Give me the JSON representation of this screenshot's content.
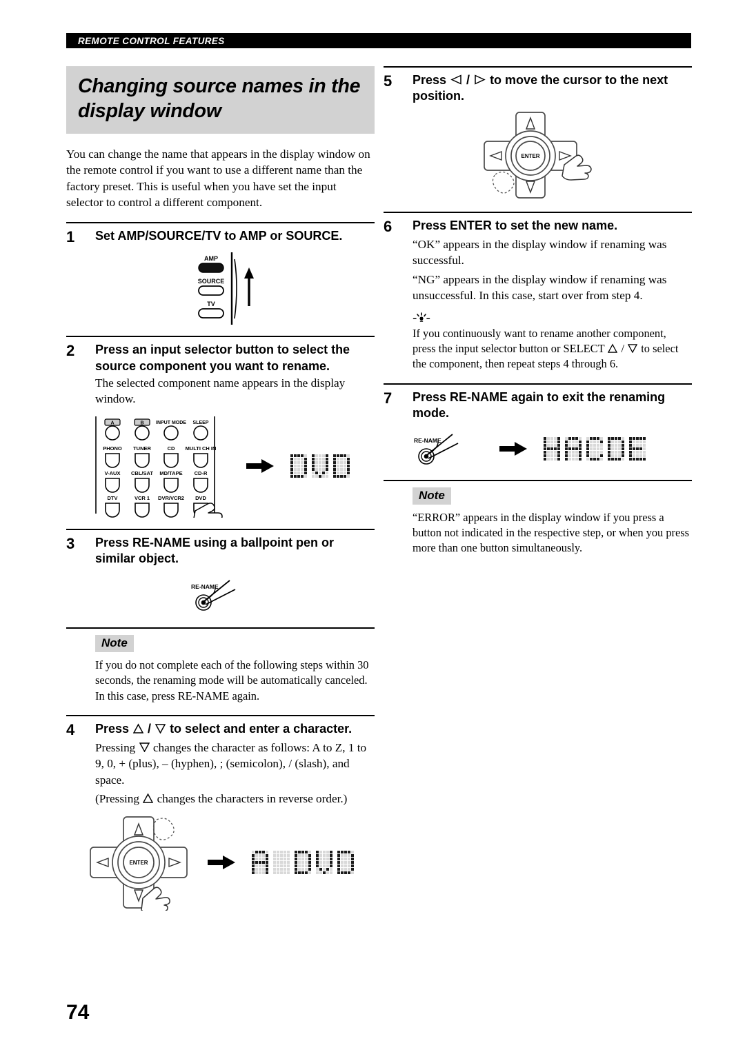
{
  "running_head": "REMOTE CONTROL FEATURES",
  "page_number": "74",
  "section": {
    "title": "Changing source names in the display window",
    "intro": "You can change the name that appears in the display window on the remote control if you want to use a different name than the factory preset. This is useful when you have set the input selector to control a different component."
  },
  "steps": [
    {
      "number": "1",
      "title": "Set AMP/SOURCE/TV to AMP or SOURCE.",
      "body": ""
    },
    {
      "number": "2",
      "title": "Press an input selector button to select the source component you want to rename.",
      "body": "The selected component name appears in the display window."
    },
    {
      "number": "3",
      "title": "Press RE-NAME using a ballpoint pen or similar object.",
      "body": ""
    },
    {
      "number": "4",
      "title_pre": "Press ",
      "title_mid": " / ",
      "title_post": " to select and enter a character.",
      "body_line1_pre": "Pressing ",
      "body_line1_post": " changes the character as follows: A to Z, 1 to 9, 0, + (plus), – (hyphen), ; (semicolon), / (slash), and space.",
      "body_line2_pre": "(Pressing ",
      "body_line2_post": " changes the characters in reverse order.)"
    },
    {
      "number": "5",
      "title_pre": "Press ",
      "title_mid": " / ",
      "title_post": " to move the cursor to the next position."
    },
    {
      "number": "6",
      "title": "Press ENTER to set the new name.",
      "body_line1": "“OK” appears in the display window if renaming was successful.",
      "body_line2": "“NG” appears in the display window if renaming was unsuccessful. In this case, start over from step 4."
    },
    {
      "number": "7",
      "title": "Press RE-NAME again to exit the renaming mode.",
      "body": ""
    }
  ],
  "notes": {
    "tag": "Note",
    "left_text": "If you do not complete each of the following steps within 30 seconds, the renaming mode will be automatically canceled. In this case, press RE-NAME again.",
    "right_text": "“ERROR” appears in the display window if you press a button not indicated in the respective step, or when you press more than one button simultaneously."
  },
  "tip": {
    "text_pre": "If you continuously want to rename another component, press the input selector button or SELECT ",
    "text_mid": " / ",
    "text_post": " to select the component, then repeat steps 4 through 6."
  },
  "figures": {
    "mode_switch": {
      "labels": [
        "AMP",
        "SOURCE",
        "TV"
      ],
      "selected": "AMP"
    },
    "input_selector_grid": {
      "rows": [
        [
          "A",
          "B",
          "INPUT MODE",
          "SLEEP"
        ],
        [
          "PHONO",
          "TUNER",
          "CD",
          "MULTI CH IN"
        ],
        [
          "V-AUX",
          "CBL/SAT",
          "MD/TAPE",
          "CD-R"
        ],
        [
          "DTV",
          "VCR 1",
          "DVR/VCR2",
          "DVD"
        ]
      ],
      "pressed": "DVD"
    },
    "rename_button_label": "RE-NAME",
    "cursor_pad": {
      "center_label": "ENTER",
      "up": "up-triangle",
      "down": "down-triangle",
      "left": "left-triangle",
      "right": "right-triangle"
    },
    "lcd_step2": "DVD",
    "lcd_step4": "A DVD",
    "lcd_step7": "HACDE"
  },
  "colors": {
    "band_gray": "#d2d2d2",
    "rule_black": "#000000",
    "lcd_off": "#d9d9d9",
    "lcd_on": "#1a1a1a"
  }
}
